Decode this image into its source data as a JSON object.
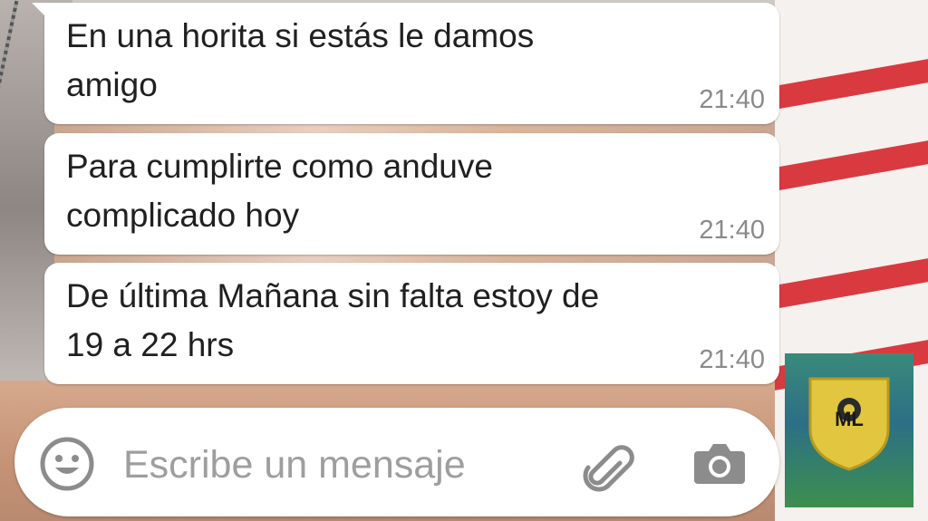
{
  "messages": [
    {
      "text": "En una horita si estás le damos\namigo",
      "time": "21:40"
    },
    {
      "text": "Para cumplirte como anduve\ncomplicado hoy",
      "time": "21:40"
    },
    {
      "text": "De última Mañana sin falta estoy de\n19 a 22 hrs",
      "time": "21:40"
    }
  ],
  "composer": {
    "placeholder": "Escribe un mensaje",
    "icons": [
      "emoji-icon",
      "attach-icon",
      "camera-icon"
    ]
  },
  "overlay_badge": {
    "logo_text": "ML"
  },
  "colors": {
    "bubble": "#ffffff",
    "text": "#202020",
    "time": "#8a8a8a",
    "placeholder": "#9e9e9e",
    "icon": "#8c8c8c"
  }
}
